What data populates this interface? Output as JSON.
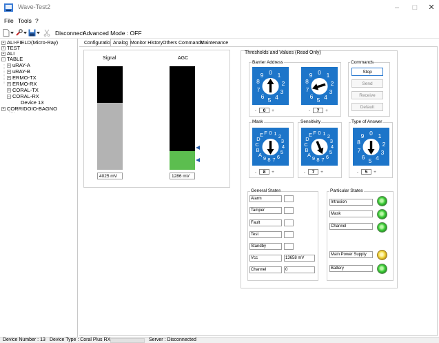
{
  "window": {
    "title": "Wave-Test2",
    "controls": {
      "minimize": "–",
      "maximize": "□",
      "close": "✕"
    }
  },
  "menu": {
    "file": "File",
    "tools": "Tools",
    "help": "?"
  },
  "toolbar": {
    "disconnect": "Disconnect",
    "mode": "Advanced Mode : OFF"
  },
  "tree": [
    {
      "label": "ALI-FIELD(Micro-Ray)",
      "expander": "+"
    },
    {
      "label": "TEST",
      "expander": "+"
    },
    {
      "label": "ALI",
      "expander": "+"
    },
    {
      "label": "TABLE",
      "expander": "−"
    },
    {
      "label": "uRAY-A",
      "expander": "+"
    },
    {
      "label": "uRAY-B",
      "expander": "+"
    },
    {
      "label": "ERMO-TX",
      "expander": "+"
    },
    {
      "label": "ERMO-RX",
      "expander": "+"
    },
    {
      "label": "CORAL-TX",
      "expander": "+"
    },
    {
      "label": "CORAL-RX",
      "expander": "−"
    },
    {
      "label": "Device 13",
      "expander": ""
    },
    {
      "label": "CORRIDOIO-BAGNO",
      "expander": "+"
    }
  ],
  "tabs": [
    "Configuration",
    "Analog",
    "Monitor History",
    "Others Commands",
    "Maintenance"
  ],
  "active_tab": "Analog",
  "signal": {
    "signal_label": "Signal",
    "signal_value": "4025 mV",
    "agc_label": "AGC",
    "agc_value": "1286 mV",
    "signal_fill": 0.65,
    "agc_fill": 0.18,
    "colors": {
      "black": "#000000",
      "signal_fill": "#b3b3b3",
      "agc_fill": "#5cbe4f",
      "marker": "#2b5ea8"
    }
  },
  "thresholds": {
    "title": "Thresholds and Values (Read Only)",
    "barrier_label": "Barrier Address",
    "barrier_digit1": "0",
    "barrier_digit2": "7",
    "mask_label": "Mask",
    "mask_value": "8",
    "sensitivity_label": "Sensitivity",
    "sensitivity_value": "7",
    "answer_label": "Type of Answer",
    "answer_value": "5",
    "spin_minus": "-",
    "spin_plus": "+",
    "dial_dec_digits": [
      "0",
      "1",
      "2",
      "3",
      "4",
      "5",
      "6",
      "7",
      "8",
      "9"
    ],
    "dial_hex_digits": [
      "0",
      "1",
      "2",
      "3",
      "4",
      "5",
      "6",
      "7",
      "8",
      "9",
      "A",
      "B",
      "C",
      "D",
      "E",
      "F"
    ],
    "dial_color": "#1d75c9"
  },
  "commands": {
    "title": "Commands",
    "stop": "Stop",
    "send": "Send",
    "receive": "Receive",
    "default": "Default"
  },
  "general_states": {
    "title": "General States",
    "rows": [
      {
        "label": "Alarm",
        "value": ""
      },
      {
        "label": "Tamper",
        "value": ""
      },
      {
        "label": "Fault",
        "value": ""
      },
      {
        "label": "Test",
        "value": ""
      },
      {
        "label": "Standby",
        "value": ""
      },
      {
        "label": "Vcc",
        "value": "13658 mV"
      },
      {
        "label": "Channel",
        "value": "0"
      }
    ]
  },
  "particular_states": {
    "title": "Particular States",
    "rows": [
      {
        "label": "Intrusion",
        "led": "green"
      },
      {
        "label": "Mask",
        "led": "green"
      },
      {
        "label": "Channel",
        "led": "green"
      },
      {
        "label": "Main Power Supply",
        "led": "yellow"
      },
      {
        "label": "Battery",
        "led": "green"
      }
    ]
  },
  "status": {
    "device_number": "Device Number : 13",
    "device_type": "Device Type : Coral Plus RX",
    "server": "Server : Disconnected"
  }
}
